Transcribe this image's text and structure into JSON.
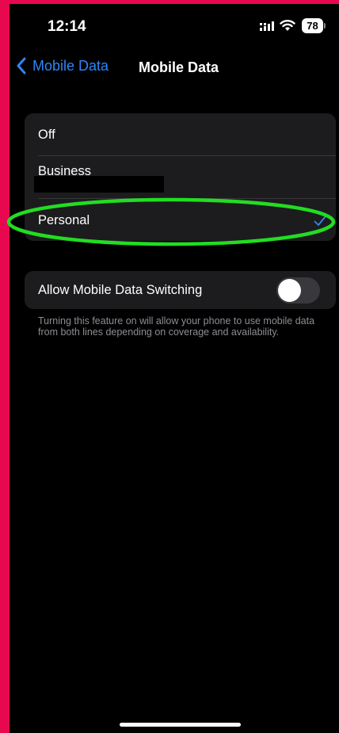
{
  "status_bar": {
    "time": "12:14",
    "battery_level": "78",
    "icons": [
      "signal-icon",
      "wifi-icon",
      "battery-icon"
    ]
  },
  "nav": {
    "back_label": "Mobile Data",
    "title": "Mobile Data"
  },
  "lines": {
    "options": [
      {
        "label": "Off",
        "selected": false
      },
      {
        "label": "Business",
        "selected": false
      },
      {
        "label": "Personal",
        "selected": true
      }
    ]
  },
  "data_switching": {
    "label": "Allow Mobile Data Switching",
    "enabled": false,
    "footnote": "Turning this feature on will allow your phone to use mobile data from both lines depending on coverage and availability."
  },
  "colors": {
    "accent": "#2f86f7",
    "background": "#000000",
    "group_background": "#1c1c1e",
    "highlight": "#22dd22",
    "outer_border": "#e8084f"
  }
}
